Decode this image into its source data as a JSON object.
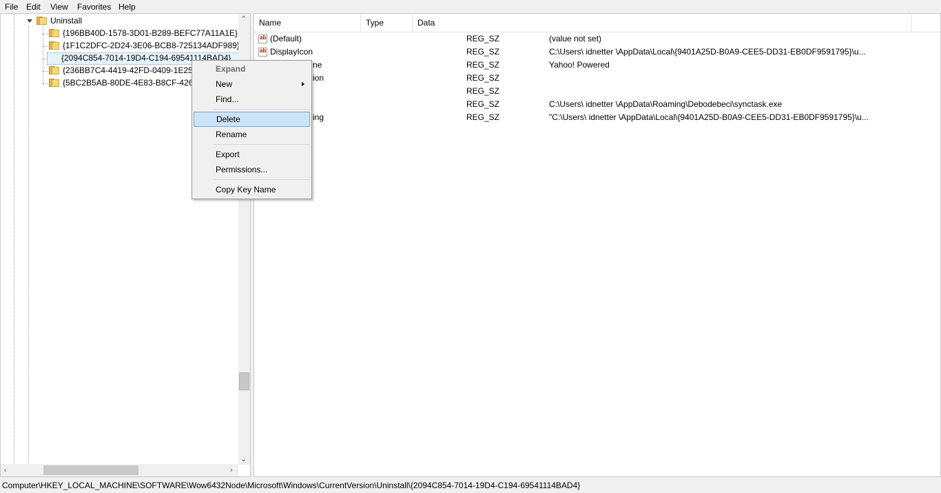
{
  "menubar": {
    "items": [
      "File",
      "Edit",
      "View",
      "Favorites",
      "Help"
    ]
  },
  "tree": {
    "parent_label": "Uninstall",
    "children": [
      "{196BB40D-1578-3D01-B289-BEFC77A11A1E}",
      "{1F1C2DFC-2D24-3E06-BCB8-725134ADF989}",
      "{2094C854-7014-19D4-C194-69541114BAD4}",
      "{236BB7C4-4419-42FD-0409-1E257A",
      "{5BC2B5AB-80DE-4E83-B8CF-42690"
    ],
    "selected_index": 2
  },
  "values": {
    "columns": [
      "Name",
      "Type",
      "Data"
    ],
    "rows": [
      {
        "name": "(Default)",
        "type": "REG_SZ",
        "data": "(value not set)"
      },
      {
        "name": "DisplayIcon",
        "type": "REG_SZ",
        "data": "C:\\Users\\ idnetter \\AppData\\Local\\{9401A25D-B0A9-CEE5-DD31-EB0DF9591795}\\u..."
      },
      {
        "name": "ne",
        "type": "REG_SZ",
        "data": "Yahoo! Powered"
      },
      {
        "name": "ion",
        "type": "REG_SZ",
        "data": ""
      },
      {
        "name": "",
        "type": "REG_SZ",
        "data": ""
      },
      {
        "name": "",
        "type": "REG_SZ",
        "data": "C:\\Users\\ idnetter \\AppData\\Roaming\\Debodebeci\\synctask.exe"
      },
      {
        "name": "ing",
        "type": "REG_SZ",
        "data": "\"C:\\Users\\ idnetter \\AppData\\Local\\{9401A25D-B0A9-CEE5-DD31-EB0DF9591795}\\u..."
      }
    ]
  },
  "context_menu": {
    "items": [
      {
        "label": "Expand",
        "disabled": true
      },
      {
        "label": "New",
        "submenu": true
      },
      {
        "label": "Find..."
      },
      {
        "label": "Delete",
        "highlighted": true
      },
      {
        "label": "Rename"
      },
      {
        "label": "Export"
      },
      {
        "label": "Permissions..."
      },
      {
        "label": "Copy Key Name"
      }
    ]
  },
  "statusbar": {
    "path": "Computer\\HKEY_LOCAL_MACHINE\\SOFTWARE\\Wow6432Node\\Microsoft\\Windows\\CurrentVersion\\Uninstall\\{2094C854-7014-19D4-C194-69541114BAD4}"
  },
  "icons": {
    "folder": "folder-icon",
    "string_value": "reg-sz-icon",
    "expander": "collapse-triangle-icon"
  }
}
